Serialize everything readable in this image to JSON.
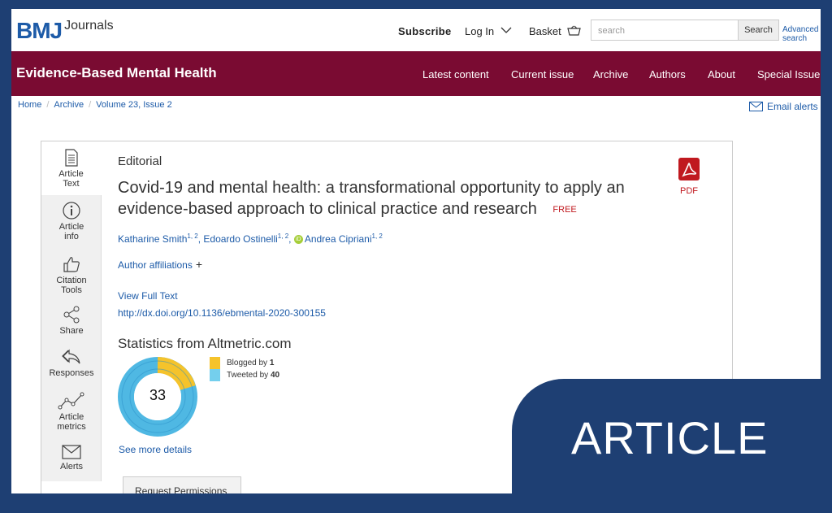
{
  "header": {
    "logo_bmj": "BMJ",
    "logo_journals": "Journals",
    "subscribe": "Subscribe",
    "login": "Log In",
    "basket": "Basket",
    "search_placeholder": "search",
    "search_button": "Search",
    "advanced_search": "Advanced search"
  },
  "journal_bar": {
    "title": "Evidence-Based Mental Health",
    "nav": [
      "Latest content",
      "Current issue",
      "Archive",
      "Authors",
      "About",
      "Special Issue"
    ]
  },
  "breadcrumb": [
    "Home",
    "Archive",
    "Volume 23, Issue 2"
  ],
  "email_alerts": "Email alerts",
  "tools": [
    {
      "label": "Article Text",
      "icon": "document-icon"
    },
    {
      "label": "Article info",
      "icon": "info-icon"
    },
    {
      "label": "Citation Tools",
      "icon": "thumbs-up-icon"
    },
    {
      "label": "Share",
      "icon": "share-icon"
    },
    {
      "label": "Responses",
      "icon": "reply-icon"
    },
    {
      "label": "Article metrics",
      "icon": "metrics-icon"
    },
    {
      "label": "Alerts",
      "icon": "envelope-icon"
    }
  ],
  "article": {
    "type": "Editorial",
    "title": "Covid-19 and mental health: a transformational opportunity to apply an evidence-based approach to clinical practice and research",
    "free_label": "FREE",
    "pdf_label": "PDF",
    "authors": [
      {
        "name": "Katharine Smith",
        "sup": "1, 2"
      },
      {
        "name": "Edoardo Ostinelli",
        "sup": "1, 2"
      },
      {
        "name": "Andrea Cipriani",
        "sup": "1, 2"
      }
    ],
    "affiliations": "Author affiliations",
    "view_full_text": "View Full Text",
    "doi": "http://dx.doi.org/10.1136/ebmental-2020-300155"
  },
  "altmetric": {
    "title": "Statistics from Altmetric.com",
    "score": "33",
    "blogged_label": "Blogged by",
    "blogged_count": "1",
    "tweeted_label": "Tweeted by",
    "tweeted_count": "40",
    "see_more": "See more details",
    "colors": {
      "blogged": "#f5c32b",
      "tweeted": "#74cfed"
    }
  },
  "request_permissions": "Request Permissions",
  "banner": "ARTICLE",
  "colors": {
    "brand_blue": "#1d5ba8",
    "journal_bar": "#7a0b32",
    "frame": "#1e3f73",
    "pdf_red": "#c0191f"
  }
}
